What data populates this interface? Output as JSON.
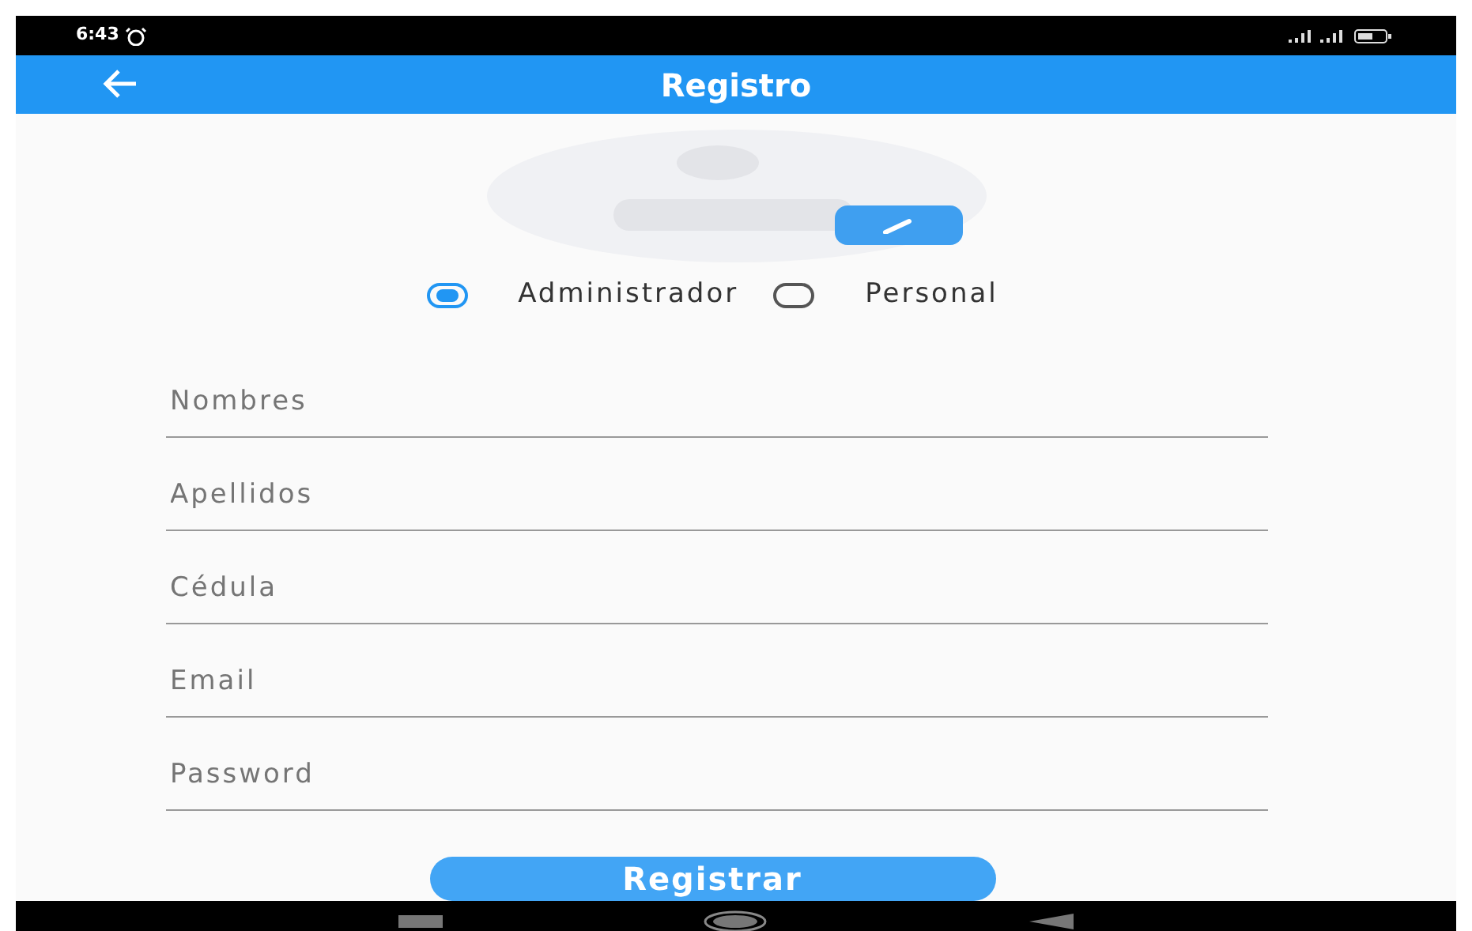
{
  "status_bar": {
    "time": "6:43"
  },
  "app_bar": {
    "title": "Registro"
  },
  "roles": [
    {
      "label": "Administrador",
      "selected": true
    },
    {
      "label": "Personal",
      "selected": false
    }
  ],
  "fields": [
    {
      "placeholder": "Nombres"
    },
    {
      "placeholder": "Apellidos"
    },
    {
      "placeholder": "Cédula"
    },
    {
      "placeholder": "Email"
    },
    {
      "placeholder": "Password"
    }
  ],
  "submit": {
    "label": "Registrar"
  }
}
